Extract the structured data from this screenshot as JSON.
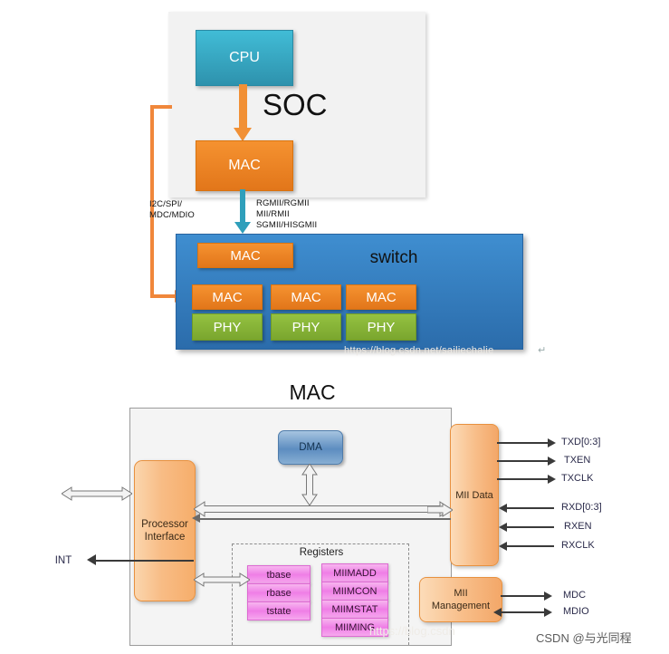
{
  "top_diagram": {
    "soc_label": "SOC",
    "cpu_label": "CPU",
    "mac_label": "MAC",
    "switch_label": "switch",
    "switch_uplink_mac": "MAC",
    "port_macs": [
      "MAC",
      "MAC",
      "MAC"
    ],
    "port_phys": [
      "PHY",
      "PHY",
      "PHY"
    ],
    "mgmt_bus_label": "I2C/SPI/\nMDC/MDIO",
    "mgmt_bus_line1": "I2C/SPI/",
    "mgmt_bus_line2": "MDC/MDIO",
    "data_bus_line1": "RGMII/RGMII",
    "data_bus_line2": "MII/RMII",
    "data_bus_line3": "SGMII/HISGMII",
    "pilcrow": "↵",
    "watermark": "https://blog.csdn.net/sailiechalie"
  },
  "bottom_diagram": {
    "title": "MAC",
    "dma_label": "DMA",
    "processor_interface_line1": "Processor",
    "processor_interface_line2": "Interface",
    "mii_data_label": "MII Data",
    "mii_management_line1": "MII",
    "mii_management_line2": "Management",
    "int_label": "INT",
    "registers_label": "Registers",
    "registers_col_a": [
      "tbase",
      "rbase",
      "tstate"
    ],
    "registers_col_b": [
      "MIIMADD",
      "MIIMCON",
      "MIIMSTAT",
      "MIIMING"
    ],
    "tx_signals": [
      "TXD[0:3]",
      "TXEN",
      "TXCLK"
    ],
    "rx_signals": [
      "RXD[0:3]",
      "RXEN",
      "RXCLK"
    ],
    "mdio_signals": [
      "MDC",
      "MDIO"
    ],
    "watermark_faint": "https://blog.csdn",
    "watermark_csdn": "CSDN @与光同程"
  },
  "colors": {
    "orange": "#f0873b",
    "teal": "#2f9fbb",
    "switch_blue": "#3f8ed0",
    "phy_green": "#94c241",
    "register_pink": "#ef7ee6",
    "soc_gray": "#f2f2f2"
  }
}
